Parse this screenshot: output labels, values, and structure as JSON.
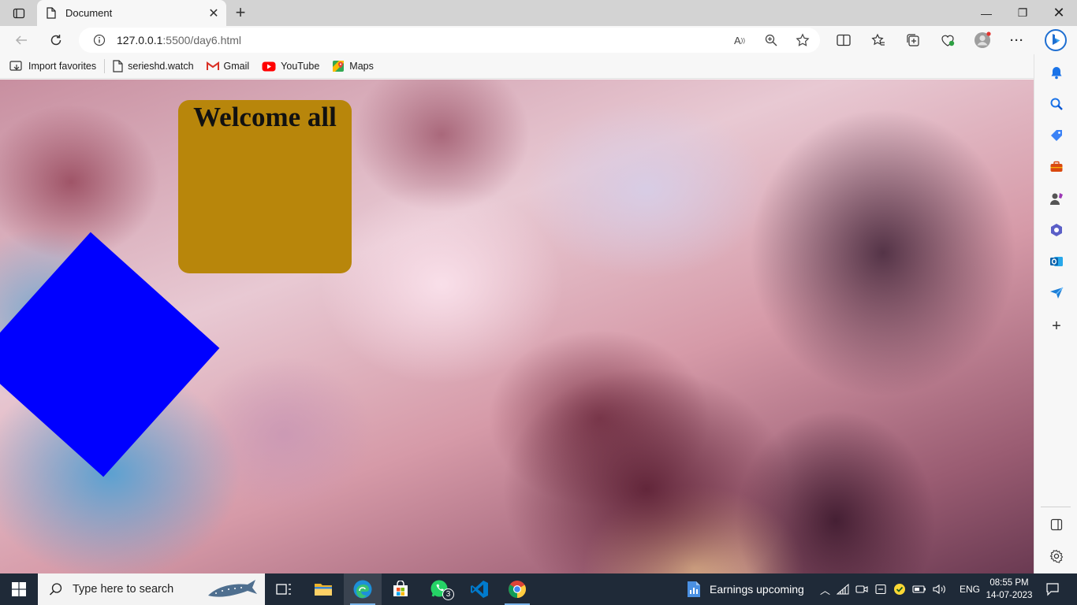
{
  "browser": {
    "tab": {
      "title": "Document"
    },
    "address": {
      "host": "127.0.0.1",
      "path": ":5500/day6.html"
    },
    "favorites": [
      {
        "label": "Import favorites",
        "icon": "import-icon"
      },
      {
        "label": "serieshd.watch",
        "icon": "page-icon"
      },
      {
        "label": "Gmail",
        "icon": "gmail-icon"
      },
      {
        "label": "YouTube",
        "icon": "youtube-icon"
      },
      {
        "label": "Maps",
        "icon": "maps-icon"
      }
    ]
  },
  "page": {
    "heading": "Welcome all",
    "colors": {
      "box": "#b8860b",
      "diamond": "#0000ff"
    }
  },
  "taskbar": {
    "search_placeholder": "Type here to search",
    "whatsapp_badge": "3",
    "news": "Earnings upcoming",
    "lang": "ENG",
    "time": "08:55 PM",
    "date": "14-07-2023"
  }
}
